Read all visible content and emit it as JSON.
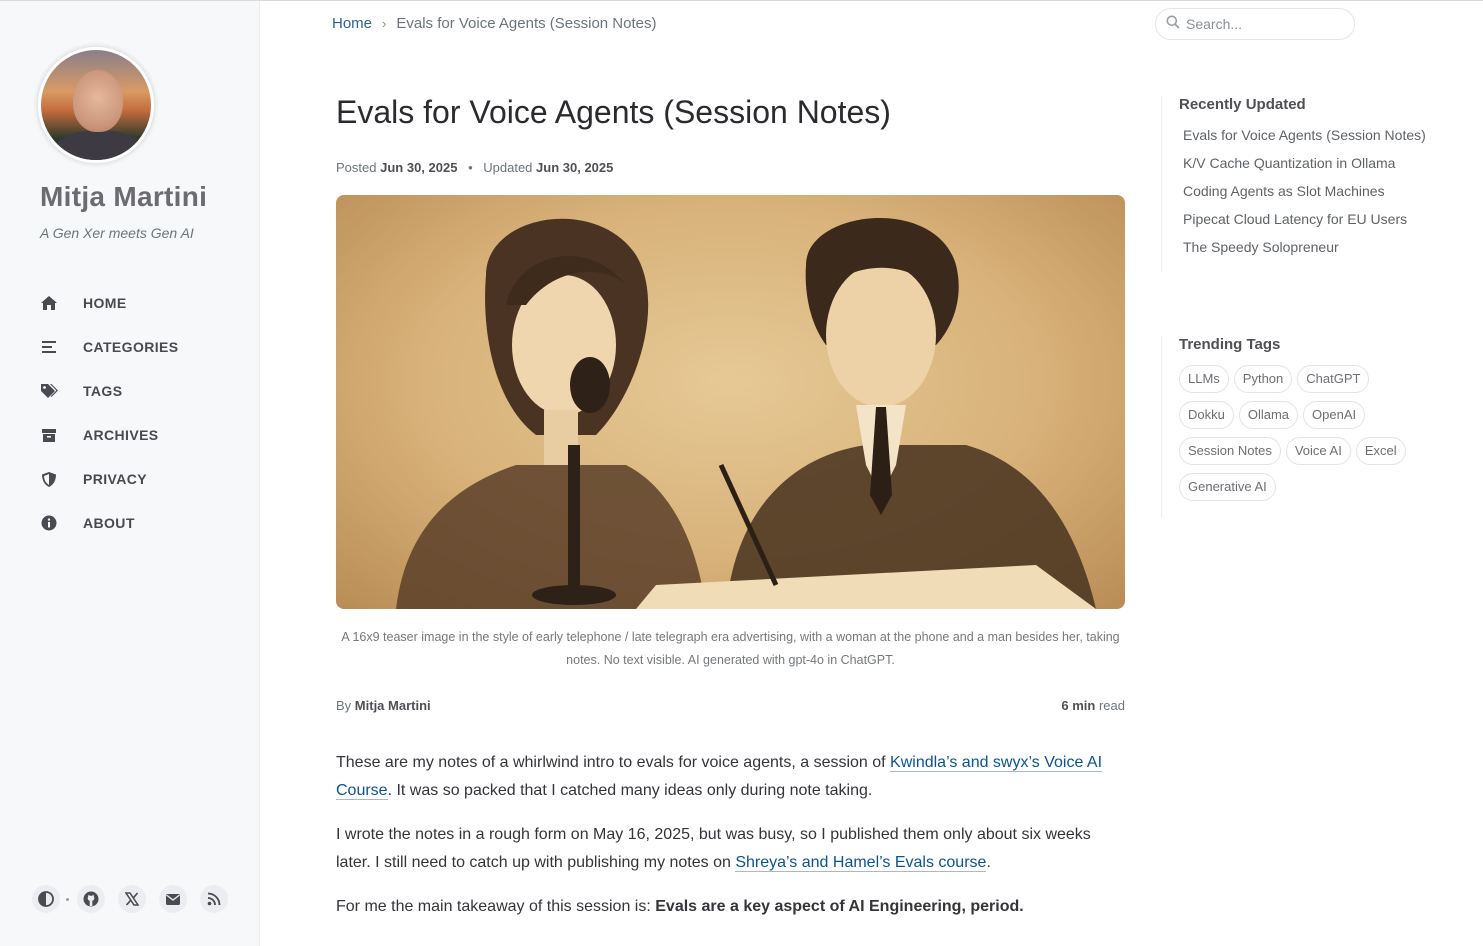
{
  "sidebar": {
    "site_title": "Mitja Martini",
    "subtitle": "A Gen Xer meets Gen AI",
    "nav": [
      {
        "label": "HOME",
        "icon": "home-icon"
      },
      {
        "label": "CATEGORIES",
        "icon": "list-icon"
      },
      {
        "label": "TAGS",
        "icon": "tags-icon"
      },
      {
        "label": "ARCHIVES",
        "icon": "archive-icon"
      },
      {
        "label": "PRIVACY",
        "icon": "shield-icon"
      },
      {
        "label": "ABOUT",
        "icon": "info-icon"
      }
    ],
    "bottom_icons": [
      "theme-toggle-icon",
      "github-icon",
      "x-twitter-icon",
      "email-icon",
      "rss-icon"
    ]
  },
  "topbar": {
    "breadcrumb_home": "Home",
    "breadcrumb_sep": "›",
    "breadcrumb_current": "Evals for Voice Agents (Session Notes)",
    "search_placeholder": "Search..."
  },
  "post": {
    "title": "Evals for Voice Agents (Session Notes)",
    "posted_label": "Posted",
    "posted_date": "Jun 30, 2025",
    "meta_dot": "•",
    "updated_label": "Updated",
    "updated_date": "Jun 30, 2025",
    "caption": "A 16x9 teaser image in the style of early telephone / late telegraph era advertising, with a woman at the phone and a man besides her, taking notes. No text visible. AI generated with gpt-4o in ChatGPT.",
    "by_label": "By",
    "author": "Mitja Martini",
    "read_minutes": "6 min",
    "read_label": "read",
    "p1_before": "These are my notes of a whirlwind intro to evals for voice agents, a session of ",
    "p1_link": "Kwindla’s and swyx’s Voice AI Course",
    "p1_after": ". It was so packed that I catched many ideas only during note taking.",
    "p2_before": "I wrote the notes in a rough form on May 16, 2025, but was busy, so I published them only about six weeks later. I still need to catch up with publishing my notes on ",
    "p2_link": "Shreya’s and Hamel’s Evals course",
    "p2_after": ".",
    "p3_before": "For me the main takeaway of this session is: ",
    "p3_bold": "Evals are a key aspect of AI Engineering, period."
  },
  "panel": {
    "recent_title": "Recently Updated",
    "recent": [
      "Evals for Voice Agents (Session Notes)",
      "K/V Cache Quantization in Ollama",
      "Coding Agents as Slot Machines",
      "Pipecat Cloud Latency for EU Users",
      "The Speedy Solopreneur"
    ],
    "tags_title": "Trending Tags",
    "tags": [
      "LLMs",
      "Python",
      "ChatGPT",
      "Dokku",
      "Ollama",
      "OpenAI",
      "Session Notes",
      "Voice AI",
      "Excel",
      "Generative AI"
    ]
  },
  "colors": {
    "link": "#0b5394",
    "sidebar_bg": "#f6f8fa",
    "title": "#2a2a30"
  }
}
